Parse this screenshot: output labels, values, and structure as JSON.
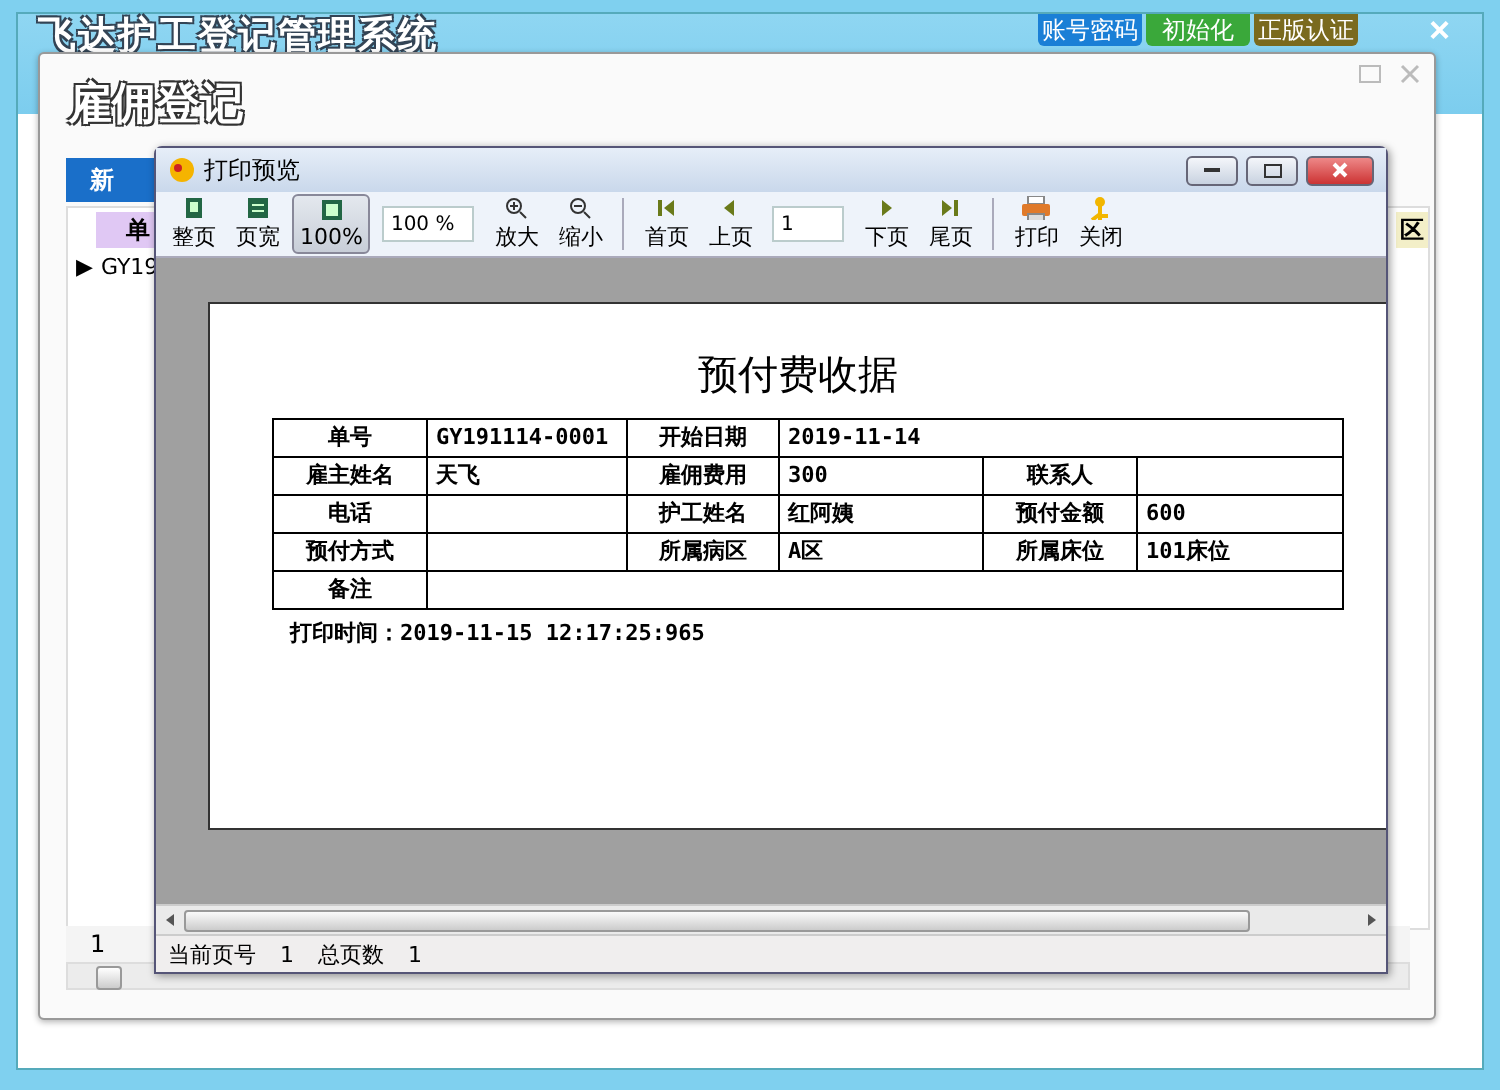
{
  "app": {
    "title": "飞达护工登记管理系统",
    "buttons": [
      {
        "label": "账号密码",
        "color": "#1a7fd6"
      },
      {
        "label": "初始化",
        "color": "#3aa83a"
      },
      {
        "label": "正版认证",
        "color": "#7a6a1e"
      }
    ],
    "close": "×"
  },
  "dialog": {
    "title": "雇佣登记",
    "add_button": "新",
    "table": {
      "columns": [
        "单",
        "区"
      ],
      "rows": [
        {
          "marker": "▶",
          "cell": "GY19"
        }
      ],
      "footer": "1"
    }
  },
  "preview": {
    "title": "打印预览",
    "toolbar": [
      {
        "kind": "button",
        "label": "整页",
        "selected": false
      },
      {
        "kind": "button",
        "label": "页宽",
        "selected": false
      },
      {
        "kind": "button",
        "label": "100%",
        "selected": true
      },
      {
        "kind": "field",
        "value": "100 %"
      },
      {
        "kind": "button",
        "label": "放大",
        "selected": false
      },
      {
        "kind": "button",
        "label": "缩小",
        "selected": false
      },
      {
        "kind": "separator"
      },
      {
        "kind": "button",
        "label": "首页",
        "selected": false
      },
      {
        "kind": "button",
        "label": "上页",
        "selected": false
      },
      {
        "kind": "field",
        "value": "1"
      },
      {
        "kind": "button",
        "label": "下页",
        "selected": false
      },
      {
        "kind": "button",
        "label": "尾页",
        "selected": false
      },
      {
        "kind": "separator"
      },
      {
        "kind": "button",
        "label": "打印",
        "selected": false
      },
      {
        "kind": "button",
        "label": "关闭",
        "selected": false
      }
    ],
    "receipt": {
      "title": "预付费收据",
      "rows": [
        [
          {
            "kind": "label",
            "text": "单号"
          },
          {
            "kind": "value",
            "text": "GY191114-0001"
          },
          {
            "kind": "label",
            "text": "开始日期"
          },
          {
            "kind": "value",
            "text": "2019-11-14",
            "wide": true
          }
        ],
        [
          {
            "kind": "label",
            "text": "雇主姓名"
          },
          {
            "kind": "value",
            "text": "天飞"
          },
          {
            "kind": "label",
            "text": "雇佣费用"
          },
          {
            "kind": "value",
            "text": "300"
          },
          {
            "kind": "label",
            "text": "联系人"
          },
          {
            "kind": "blank"
          }
        ],
        [
          {
            "kind": "label",
            "text": "电话"
          },
          {
            "kind": "blank"
          },
          {
            "kind": "label",
            "text": "护工姓名"
          },
          {
            "kind": "value",
            "text": "红阿姨"
          },
          {
            "kind": "label",
            "text": "预付金额"
          },
          {
            "kind": "value",
            "text": "600"
          }
        ],
        [
          {
            "kind": "label",
            "text": "预付方式"
          },
          {
            "kind": "blank"
          },
          {
            "kind": "label",
            "text": "所属病区"
          },
          {
            "kind": "value",
            "text": "A区"
          },
          {
            "kind": "label",
            "text": "所属床位"
          },
          {
            "kind": "value",
            "text": "101床位"
          }
        ],
        [
          {
            "kind": "label",
            "text": "备注"
          },
          {
            "kind": "blank",
            "wide": true
          }
        ]
      ],
      "print_time": "打印时间：2019-11-15 12:17:25:965"
    },
    "status": [
      {
        "label": "当前页号",
        "value": "1"
      },
      {
        "label": "总页数",
        "value": "1"
      }
    ]
  }
}
